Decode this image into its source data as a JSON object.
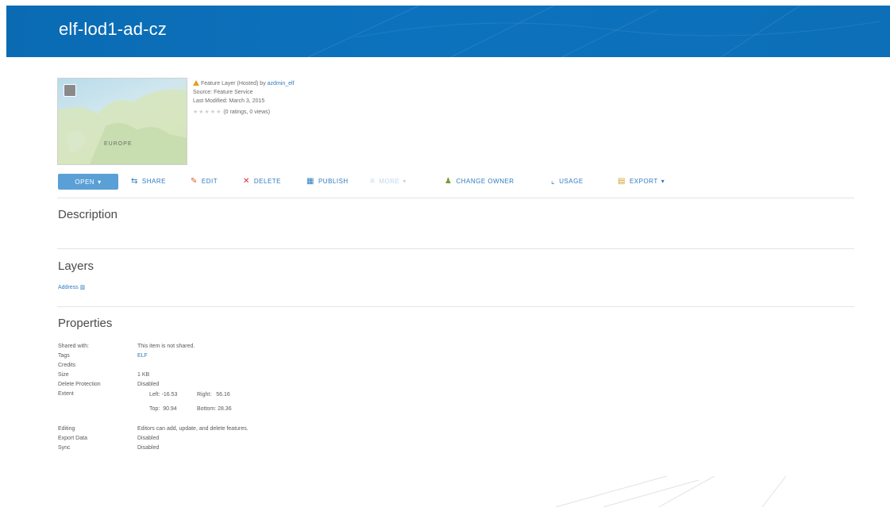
{
  "header": {
    "title": "elf-lod1-ad-cz"
  },
  "item": {
    "thumbnail_label": "EUROPE",
    "type_line_prefix": "Feature Layer (Hosted) by ",
    "owner": "azdmin_elf",
    "source_line": "Source: Feature Service",
    "modified_line": "Last Modified: March 3, 2015",
    "rating_text": "(0 ratings, 0 views)"
  },
  "toolbar": {
    "open": "OPEN",
    "share": "SHARE",
    "edit": "EDIT",
    "delete": "DELETE",
    "publish": "PUBLISH",
    "more": "MORE",
    "change_owner": "CHANGE OWNER",
    "usage": "USAGE",
    "export": "EXPORT"
  },
  "sections": {
    "description": "Description",
    "layers": "Layers",
    "properties": "Properties"
  },
  "layers": [
    {
      "label": "Address"
    }
  ],
  "properties": {
    "shared_with": {
      "label": "Shared with:",
      "value": "This item is not shared."
    },
    "tags": {
      "label": "Tags",
      "value": "ELF"
    },
    "credits": {
      "label": "Credits",
      "value": ""
    },
    "size": {
      "label": "Size",
      "value": "1 KB"
    },
    "delete_protection": {
      "label": "Delete Protection",
      "value": "Disabled"
    },
    "extent": {
      "label": "Extent",
      "left_label": "Left:",
      "left": "-16.53",
      "right_label": "Right:",
      "right": "56.16",
      "top_label": "Top:",
      "top": "90.94",
      "bottom_label": "Bottom:",
      "bottom": "28.36"
    },
    "editing": {
      "label": "Editing",
      "value": "Editors can add, update, and delete features."
    },
    "export_data": {
      "label": "Export Data",
      "value": "Disabled"
    },
    "sync": {
      "label": "Sync",
      "value": "Disabled"
    }
  },
  "colors": {
    "banner": "#0c6fb8",
    "link": "#2f7bbf",
    "open_button": "#5aa0d6"
  }
}
